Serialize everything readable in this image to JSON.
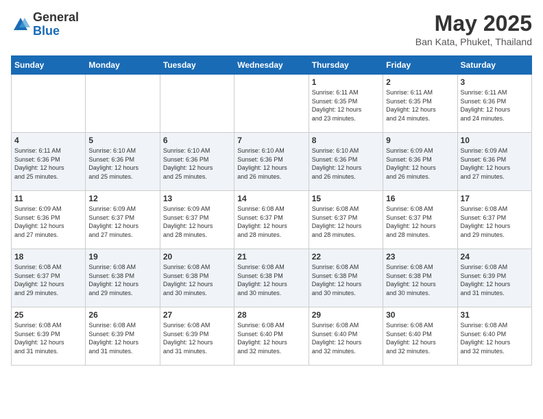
{
  "header": {
    "logo_general": "General",
    "logo_blue": "Blue",
    "month_title": "May 2025",
    "location": "Ban Kata, Phuket, Thailand"
  },
  "days_of_week": [
    "Sunday",
    "Monday",
    "Tuesday",
    "Wednesday",
    "Thursday",
    "Friday",
    "Saturday"
  ],
  "weeks": [
    [
      {
        "day": "",
        "info": ""
      },
      {
        "day": "",
        "info": ""
      },
      {
        "day": "",
        "info": ""
      },
      {
        "day": "",
        "info": ""
      },
      {
        "day": "1",
        "info": "Sunrise: 6:11 AM\nSunset: 6:35 PM\nDaylight: 12 hours\nand 23 minutes."
      },
      {
        "day": "2",
        "info": "Sunrise: 6:11 AM\nSunset: 6:35 PM\nDaylight: 12 hours\nand 24 minutes."
      },
      {
        "day": "3",
        "info": "Sunrise: 6:11 AM\nSunset: 6:36 PM\nDaylight: 12 hours\nand 24 minutes."
      }
    ],
    [
      {
        "day": "4",
        "info": "Sunrise: 6:11 AM\nSunset: 6:36 PM\nDaylight: 12 hours\nand 25 minutes."
      },
      {
        "day": "5",
        "info": "Sunrise: 6:10 AM\nSunset: 6:36 PM\nDaylight: 12 hours\nand 25 minutes."
      },
      {
        "day": "6",
        "info": "Sunrise: 6:10 AM\nSunset: 6:36 PM\nDaylight: 12 hours\nand 25 minutes."
      },
      {
        "day": "7",
        "info": "Sunrise: 6:10 AM\nSunset: 6:36 PM\nDaylight: 12 hours\nand 26 minutes."
      },
      {
        "day": "8",
        "info": "Sunrise: 6:10 AM\nSunset: 6:36 PM\nDaylight: 12 hours\nand 26 minutes."
      },
      {
        "day": "9",
        "info": "Sunrise: 6:09 AM\nSunset: 6:36 PM\nDaylight: 12 hours\nand 26 minutes."
      },
      {
        "day": "10",
        "info": "Sunrise: 6:09 AM\nSunset: 6:36 PM\nDaylight: 12 hours\nand 27 minutes."
      }
    ],
    [
      {
        "day": "11",
        "info": "Sunrise: 6:09 AM\nSunset: 6:36 PM\nDaylight: 12 hours\nand 27 minutes."
      },
      {
        "day": "12",
        "info": "Sunrise: 6:09 AM\nSunset: 6:37 PM\nDaylight: 12 hours\nand 27 minutes."
      },
      {
        "day": "13",
        "info": "Sunrise: 6:09 AM\nSunset: 6:37 PM\nDaylight: 12 hours\nand 28 minutes."
      },
      {
        "day": "14",
        "info": "Sunrise: 6:08 AM\nSunset: 6:37 PM\nDaylight: 12 hours\nand 28 minutes."
      },
      {
        "day": "15",
        "info": "Sunrise: 6:08 AM\nSunset: 6:37 PM\nDaylight: 12 hours\nand 28 minutes."
      },
      {
        "day": "16",
        "info": "Sunrise: 6:08 AM\nSunset: 6:37 PM\nDaylight: 12 hours\nand 28 minutes."
      },
      {
        "day": "17",
        "info": "Sunrise: 6:08 AM\nSunset: 6:37 PM\nDaylight: 12 hours\nand 29 minutes."
      }
    ],
    [
      {
        "day": "18",
        "info": "Sunrise: 6:08 AM\nSunset: 6:37 PM\nDaylight: 12 hours\nand 29 minutes."
      },
      {
        "day": "19",
        "info": "Sunrise: 6:08 AM\nSunset: 6:38 PM\nDaylight: 12 hours\nand 29 minutes."
      },
      {
        "day": "20",
        "info": "Sunrise: 6:08 AM\nSunset: 6:38 PM\nDaylight: 12 hours\nand 30 minutes."
      },
      {
        "day": "21",
        "info": "Sunrise: 6:08 AM\nSunset: 6:38 PM\nDaylight: 12 hours\nand 30 minutes."
      },
      {
        "day": "22",
        "info": "Sunrise: 6:08 AM\nSunset: 6:38 PM\nDaylight: 12 hours\nand 30 minutes."
      },
      {
        "day": "23",
        "info": "Sunrise: 6:08 AM\nSunset: 6:38 PM\nDaylight: 12 hours\nand 30 minutes."
      },
      {
        "day": "24",
        "info": "Sunrise: 6:08 AM\nSunset: 6:39 PM\nDaylight: 12 hours\nand 31 minutes."
      }
    ],
    [
      {
        "day": "25",
        "info": "Sunrise: 6:08 AM\nSunset: 6:39 PM\nDaylight: 12 hours\nand 31 minutes."
      },
      {
        "day": "26",
        "info": "Sunrise: 6:08 AM\nSunset: 6:39 PM\nDaylight: 12 hours\nand 31 minutes."
      },
      {
        "day": "27",
        "info": "Sunrise: 6:08 AM\nSunset: 6:39 PM\nDaylight: 12 hours\nand 31 minutes."
      },
      {
        "day": "28",
        "info": "Sunrise: 6:08 AM\nSunset: 6:40 PM\nDaylight: 12 hours\nand 32 minutes."
      },
      {
        "day": "29",
        "info": "Sunrise: 6:08 AM\nSunset: 6:40 PM\nDaylight: 12 hours\nand 32 minutes."
      },
      {
        "day": "30",
        "info": "Sunrise: 6:08 AM\nSunset: 6:40 PM\nDaylight: 12 hours\nand 32 minutes."
      },
      {
        "day": "31",
        "info": "Sunrise: 6:08 AM\nSunset: 6:40 PM\nDaylight: 12 hours\nand 32 minutes."
      }
    ]
  ]
}
